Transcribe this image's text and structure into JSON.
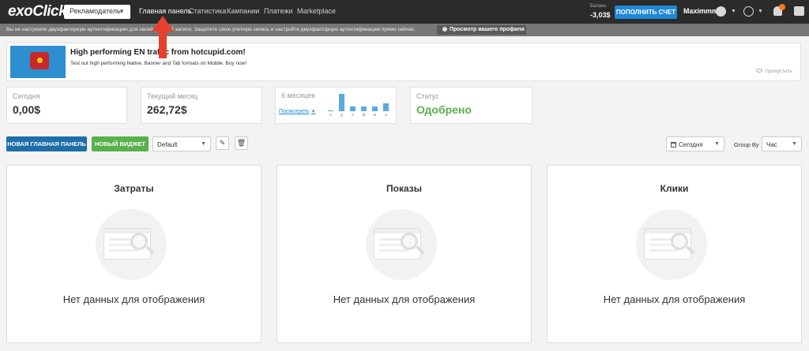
{
  "header": {
    "logo": "exoClick",
    "role_select": "Рекламодатель",
    "nav": [
      {
        "label": "Главная панель",
        "active": true
      },
      {
        "label": "Статистика",
        "active": false
      },
      {
        "label": "Кампании",
        "active": false
      },
      {
        "label": "Платежи",
        "active": false
      },
      {
        "label": "Marketplace",
        "active": false
      }
    ],
    "balance_label": "Баланс",
    "balance_value": "-3,03$",
    "topup_button": "ПОПОЛНИТЬ СЧЕТ",
    "username": "Maximmms",
    "icons": [
      "user-icon",
      "globe-icon",
      "bell-icon",
      "chat-icon"
    ],
    "brand_color": "#1e88d6"
  },
  "warning": {
    "text": "Вы не настроили двухфакторную аутентификацию для своей учетной записи. Защитите свою учетную запись и настройте двухфакторную аутентификацию прямо сейчас.",
    "profile_button": "Просмотр вашего профиля"
  },
  "ad": {
    "title": "High performing EN traffic from hotcupid.com!",
    "description": "Test out high performing Native, Banner and Tab formats on Mobile. Buy now!",
    "skip": "Пропустить"
  },
  "stats": {
    "today": {
      "label": "Сегодня",
      "value": "0,00$"
    },
    "month": {
      "label": "Текущий месяц",
      "value": "262,72$"
    },
    "six_months": {
      "label": "6 месяцев",
      "link": "Посмотреть",
      "months": [
        "н",
        "д",
        "я",
        "ф",
        "м",
        "а"
      ],
      "values": [
        0.03,
        1.0,
        0.28,
        0.28,
        0.28,
        0.45
      ]
    },
    "status": {
      "label": "Статус",
      "value": "Одобрено",
      "color": "#5ab04d"
    }
  },
  "toolbar": {
    "new_dashboard": "НОВАЯ ГЛАВНАЯ ПАНЕЛЬ",
    "new_widget": "НОВЫЙ ВИДЖЕТ",
    "dashboard_select": "Default",
    "date_select": "Сегодня",
    "group_by_label": "Group By",
    "group_by_select": "Час"
  },
  "widgets": [
    {
      "title": "Затраты",
      "empty": "Нет данных для отображения"
    },
    {
      "title": "Показы",
      "empty": "Нет данных для отображения"
    },
    {
      "title": "Клики",
      "empty": "Нет данных для отображения"
    }
  ]
}
